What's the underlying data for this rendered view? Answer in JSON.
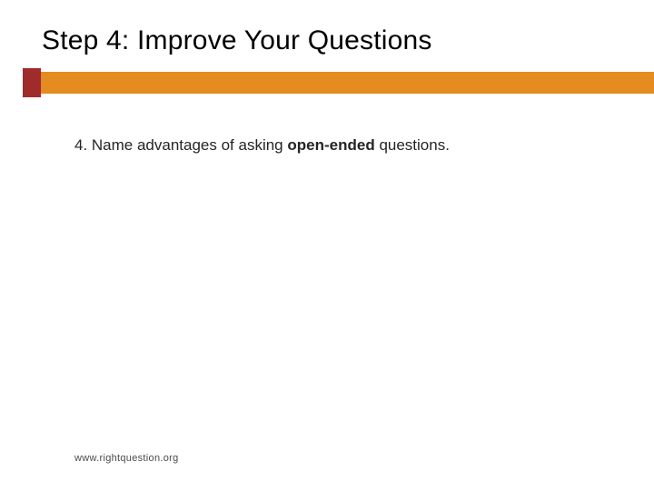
{
  "slide": {
    "title": "Step 4: Improve Your Questions",
    "body_prefix": "4. Name advantages of asking ",
    "body_bold": "open-ended",
    "body_suffix": " questions.",
    "footer": "www.rightquestion.org"
  },
  "colors": {
    "accent_block": "#a02b2b",
    "accent_bar": "#e48c1f"
  }
}
